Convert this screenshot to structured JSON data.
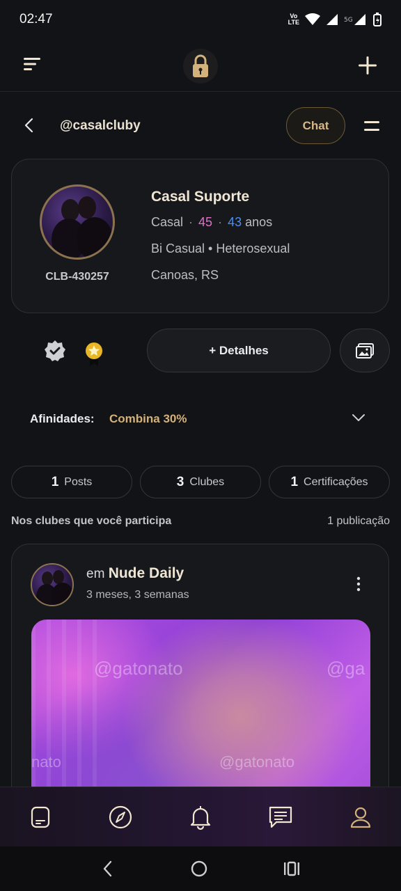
{
  "status_bar": {
    "time": "02:47",
    "network": "Vo LTE",
    "signal": "5G"
  },
  "topbar": {
    "menu_icon": "sort-menu-icon",
    "logo_icon": "lock-icon",
    "add_icon": "plus-icon"
  },
  "profile_header": {
    "handle": "@casalcluby",
    "chat_label": "Chat"
  },
  "profile": {
    "name": "Casal Suporte",
    "code": "CLB-430257",
    "type": "Casal",
    "age_1": "45",
    "age_2": "43",
    "age_unit": "anos",
    "orientation": "Bi Casual • Heterosexual",
    "location": "Canoas, RS"
  },
  "actions": {
    "details_label": "+ Detalhes"
  },
  "affinity": {
    "label": "Afinidades:",
    "value": "Combina 30%"
  },
  "stats": [
    {
      "count": "1",
      "label": "Posts"
    },
    {
      "count": "3",
      "label": "Clubes"
    },
    {
      "count": "1",
      "label": "Certificações"
    }
  ],
  "section": {
    "title": "Nos clubes que você participa",
    "count": "1 publicação"
  },
  "post": {
    "prefix": "em",
    "club": "Nude Daily",
    "time": "3 meses, 3 semanas",
    "watermark_1": "@gatonato",
    "watermark_2": "@ga",
    "watermark_3": "nato",
    "watermark_4": "@gatonato"
  },
  "colors": {
    "accent_gold": "#d3b27c",
    "age_pink": "#e070c8",
    "age_blue": "#4c8ff2",
    "background": "#121316"
  }
}
